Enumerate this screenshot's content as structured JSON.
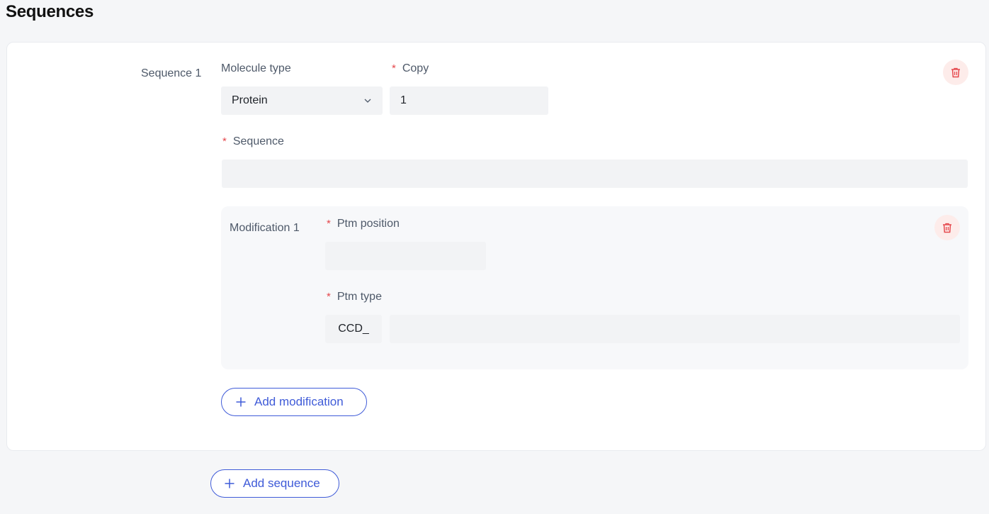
{
  "page": {
    "title": "Sequences"
  },
  "sequence": {
    "label": "Sequence 1",
    "molecule_type_label": "Molecule type",
    "molecule_type_value": "Protein",
    "copy_label": "Copy",
    "copy_value": "1",
    "sequence_label": "Sequence",
    "sequence_value": "",
    "required_mark": "*"
  },
  "modification": {
    "label": "Modification 1",
    "ptm_position_label": "Ptm position",
    "ptm_position_value": "",
    "ptm_type_label": "Ptm type",
    "ptm_type_prefix": "CCD_",
    "ptm_type_value": ""
  },
  "buttons": {
    "add_modification": "Add modification",
    "add_sequence": "Add sequence"
  },
  "icons": {
    "delete": "trash-icon",
    "dropdown": "chevron-down-icon",
    "add": "plus-icon"
  },
  "colors": {
    "accent": "#3f5bd8",
    "required": "#e5484d",
    "danger_bg": "#fdecea",
    "danger_icon": "#e5484d",
    "field_bg": "#f2f3f5"
  }
}
